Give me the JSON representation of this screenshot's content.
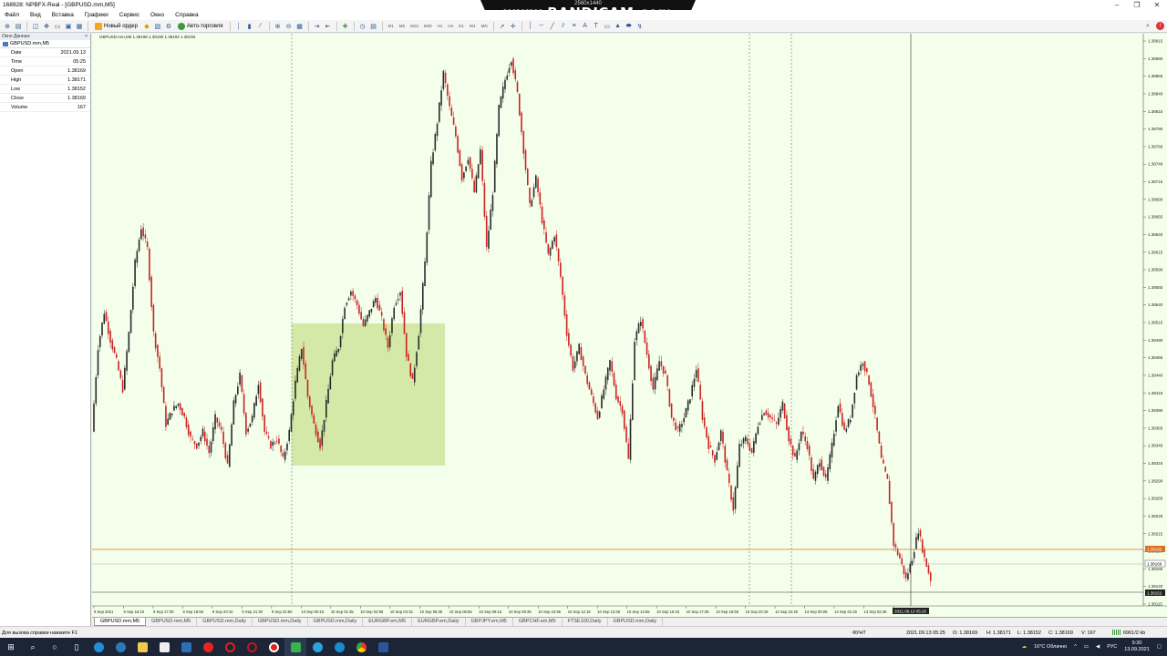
{
  "window": {
    "title": "168928: NPBFX-Real - [GBPUSD.mm,M5]"
  },
  "recorder": {
    "resolution": "2560x1440",
    "logo": "www.BANDICAM.com"
  },
  "menu": [
    "Файл",
    "Вид",
    "Вставка",
    "Графики",
    "Сервис",
    "Окно",
    "Справка"
  ],
  "toolbar": {
    "new_order": "Новый ордер",
    "auto_trading": "Авто-торговля",
    "timeframes": [
      "M1",
      "M5",
      "M15",
      "M30",
      "H1",
      "H4",
      "D1",
      "W1",
      "MN"
    ]
  },
  "data_window": {
    "title": "Окно Данных",
    "symbol": "GBPUSD.mm,M5",
    "rows": [
      {
        "key": "Date",
        "value": "2021.09.13"
      },
      {
        "key": "Time",
        "value": "05:25"
      },
      {
        "key": "Open",
        "value": "1.38169"
      },
      {
        "key": "High",
        "value": "1.38171"
      },
      {
        "key": "Low",
        "value": "1.38152"
      },
      {
        "key": "Close",
        "value": "1.38169"
      },
      {
        "key": "Volume",
        "value": "167"
      }
    ]
  },
  "chart": {
    "info": "GBPUSD.mm,M5  1.38198 1.38190 1.38192 1.38192",
    "highlight_color": "#d4e8a8",
    "bull_color": "#2a2a2a",
    "bear_color": "#cc2222",
    "price_line_color": "#e07020",
    "time_label": "2021.09.13 05:25",
    "price_tag_current": "1.38192",
    "price_tag_ask": "1.38169",
    "price_tag_low": "1.38152"
  },
  "chart_data": {
    "type": "candlestick",
    "y_tick_labels": [
      "1.38915",
      "1.38890",
      "1.38865",
      "1.38840",
      "1.38815",
      "1.38790",
      "1.38765",
      "1.38740",
      "1.38715",
      "1.38690",
      "1.38665",
      "1.38640",
      "1.38615",
      "1.38590",
      "1.38565",
      "1.38540",
      "1.38515",
      "1.38490",
      "1.38465",
      "1.38440",
      "1.38415",
      "1.38390",
      "1.38365",
      "1.38340",
      "1.38315",
      "1.38290",
      "1.38265",
      "1.38240",
      "1.38215",
      "1.38190",
      "1.38165",
      "1.38140",
      "1.38115"
    ],
    "x_tick_labels": [
      "9 Sep 2021",
      "9 Sep 16:10",
      "9 Sep 17:30",
      "9 Sep 18:50",
      "9 Sep 20:10",
      "9 Sep 21:30",
      "9 Sep 22:50",
      "10 Sep 00:15",
      "10 Sep 01:35",
      "10 Sep 02:55",
      "10 Sep 04:15",
      "10 Sep 05:35",
      "10 Sep 06:55",
      "10 Sep 08:15",
      "10 Sep 09:35",
      "10 Sep 10:55",
      "10 Sep 12:15",
      "10 Sep 13:35",
      "10 Sep 14:55",
      "10 Sep 16:15",
      "10 Sep 17:35",
      "10 Sep 18:55",
      "10 Sep 20:15",
      "12 Sep 22:45",
      "13 Sep 00:05",
      "13 Sep 01:25",
      "13 Sep 02:45",
      "13 Sep 04:05"
    ],
    "path": [
      1.3836,
      1.3848,
      1.3853,
      1.3849,
      1.3846,
      1.3842,
      1.385,
      1.386,
      1.3865,
      1.3862,
      1.385,
      1.3845,
      1.3837,
      1.3839,
      1.384,
      1.3838,
      1.3835,
      1.3834,
      1.3836,
      1.3833,
      1.3838,
      1.3836,
      1.3831,
      1.384,
      1.3844,
      1.3836,
      1.3838,
      1.3843,
      1.3836,
      1.3834,
      1.3835,
      1.3832,
      1.3836,
      1.3843,
      1.3848,
      1.3841,
      1.3837,
      1.3834,
      1.384,
      1.3846,
      1.3848,
      1.3854,
      1.3856,
      1.3854,
      1.3851,
      1.3853,
      1.3855,
      1.3852,
      1.3848,
      1.3854,
      1.3856,
      1.3847,
      1.3843,
      1.385,
      1.386,
      1.3874,
      1.388,
      1.3887,
      1.3882,
      1.3878,
      1.3872,
      1.3875,
      1.387,
      1.3876,
      1.3862,
      1.387,
      1.3882,
      1.3886,
      1.3889,
      1.3884,
      1.3876,
      1.3868,
      1.3872,
      1.3866,
      1.3861,
      1.3864,
      1.3858,
      1.385,
      1.3845,
      1.3848,
      1.3844,
      1.3841,
      1.3838,
      1.3842,
      1.3846,
      1.3841,
      1.3839,
      1.3832,
      1.3849,
      1.3852,
      1.3847,
      1.3842,
      1.3846,
      1.3844,
      1.3838,
      1.3836,
      1.3838,
      1.3841,
      1.3845,
      1.3838,
      1.3834,
      1.3832,
      1.3836,
      1.383,
      1.3825,
      1.3834,
      1.3835,
      1.3833,
      1.3837,
      1.3839,
      1.3838,
      1.3837,
      1.384,
      1.3835,
      1.3832,
      1.3836,
      1.3834,
      1.3829,
      1.3832,
      1.3829,
      1.3834,
      1.384,
      1.3836,
      1.3838,
      1.3844,
      1.3846,
      1.3843,
      1.3838,
      1.3832,
      1.3829,
      1.382,
      1.3818,
      1.3815,
      1.3818,
      1.3822,
      1.3818,
      1.3815
    ]
  },
  "tabs": [
    "GBPUSD.mm,M5",
    "GBPUSD.mm,M5",
    "GBPUSD.mm,Daily",
    "GBPUSD.mm,Daily",
    "GBPUSD.mm,Daily",
    "EURGBP.em,M5",
    "EURGBP.em,Daily",
    "GBPJPY.em,M5",
    "GBPCHF.em,M5",
    "FTSE100,Daily",
    "GBPUSD.mm,Daily"
  ],
  "status": {
    "help": "Для вызова справки нажмите F1",
    "profile": "ФУНТ",
    "datetime": "2021.09.13 05:25",
    "open": "O: 1.38169",
    "high": "H: 1.38171",
    "low": "L: 1.38152",
    "close": "C: 1.38169",
    "volume": "V: 167",
    "traffic": "6961/2 kb"
  },
  "taskbar": {
    "weather": "16°C  Облачно",
    "lang": "РУС",
    "time": "9:30",
    "date": "13.09.2021"
  }
}
